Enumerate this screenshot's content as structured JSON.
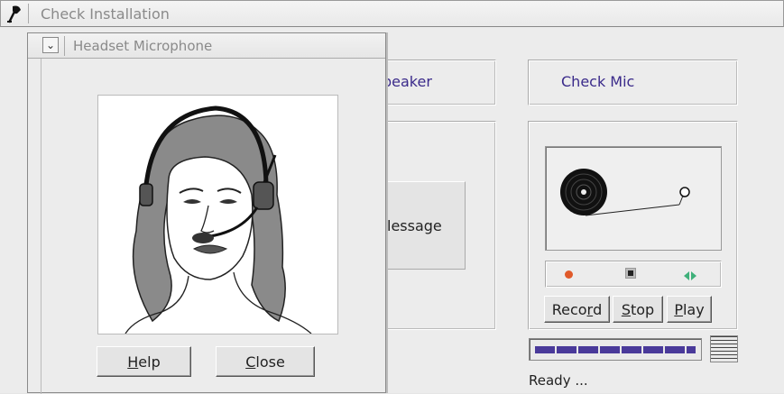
{
  "window": {
    "title": "Check Installation",
    "icon": "microphone-icon"
  },
  "panels": {
    "speaker_label": "peaker",
    "check_mic_label": "Check Mic",
    "message_button": "lessage"
  },
  "recorder": {
    "record_icon_color": "#e05a2a",
    "stop_icon_color": "#222222",
    "play_icon_color": "#3fb07a",
    "record_label_pre": "Reco",
    "record_label_u": "r",
    "record_label_post": "d",
    "stop_label_pre": "",
    "stop_label_u": "S",
    "stop_label_post": "top",
    "play_label_pre": "",
    "play_label_u": "P",
    "play_label_post": "lay",
    "progress_fraction": 1.0,
    "status": "Ready ..."
  },
  "dialog": {
    "title": "Headset Microphone",
    "menu_icon": "chevron-down-icon",
    "image": "headset-microphone-illustration",
    "help_u": "H",
    "help_post": "elp",
    "close_u": "C",
    "close_post": "lose"
  },
  "colors": {
    "accent_text": "#3a2a8a",
    "progress_fill": "#4a3a9a"
  }
}
